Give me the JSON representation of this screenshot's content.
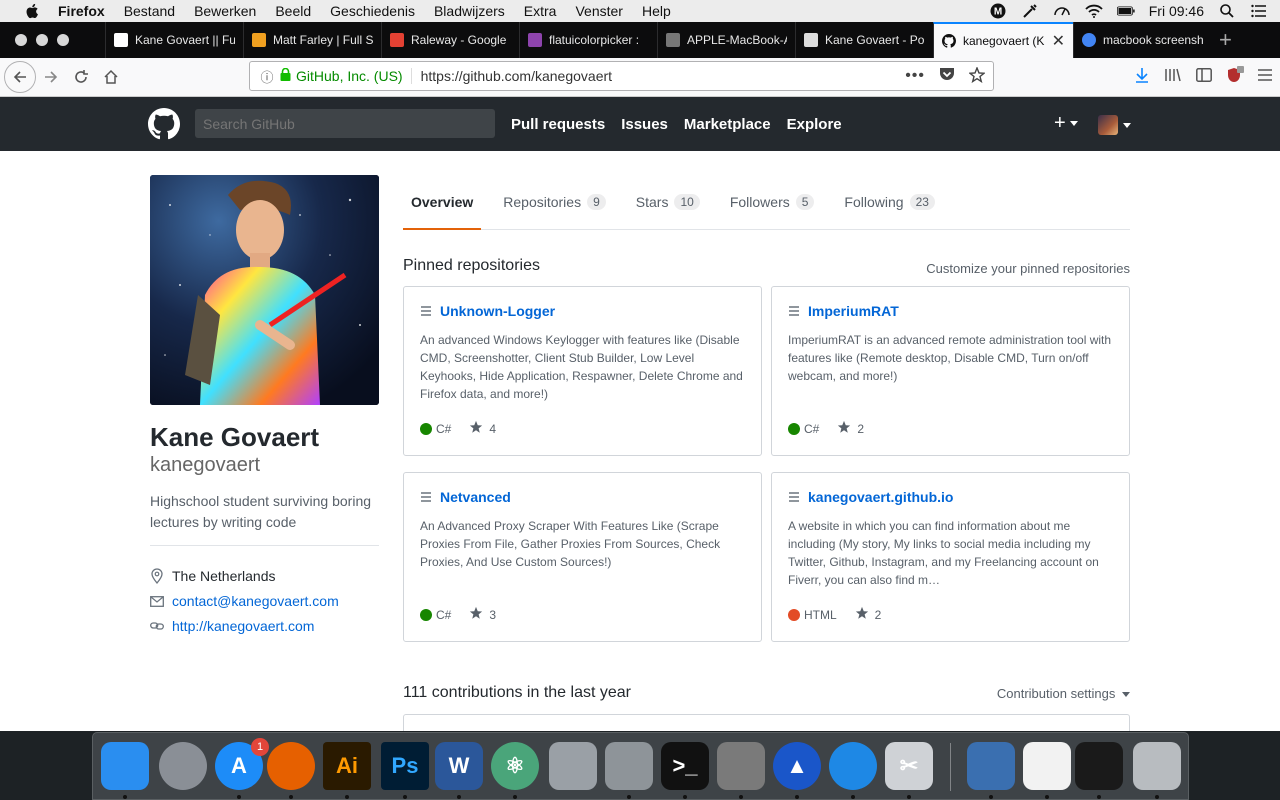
{
  "menubar": {
    "app": "Firefox",
    "items": [
      "Bestand",
      "Bewerken",
      "Beeld",
      "Geschiedenis",
      "Bladwijzers",
      "Extra",
      "Venster",
      "Help"
    ],
    "clock": "Fri 09:46"
  },
  "tabs": [
    {
      "label": "Kane Govaert || Full-St",
      "color": "#ffffff"
    },
    {
      "label": "Matt Farley | Full S",
      "color": "#f0a020"
    },
    {
      "label": "Raleway - Google",
      "color": "#e34133"
    },
    {
      "label": "flatuicolorpicker :",
      "color": "#8e44ad"
    },
    {
      "label": "APPLE-MacBook-A",
      "color": "#777777"
    },
    {
      "label": "Kane Govaert - Po",
      "color": "#dddddd"
    },
    {
      "label": "kanegovaert (K",
      "color": "#111111",
      "active": true
    },
    {
      "label": "macbook screensh",
      "color": "#4285f4"
    }
  ],
  "urlbar": {
    "org": "GitHub, Inc. (US)",
    "url": "https://github.com/kanegovaert"
  },
  "github": {
    "search_placeholder": "Search GitHub",
    "nav": [
      "Pull requests",
      "Issues",
      "Marketplace",
      "Explore"
    ]
  },
  "profile": {
    "fullname": "Kane Govaert",
    "username": "kanegovaert",
    "bio": "Highschool student surviving boring lectures by writing code",
    "location": "The Netherlands",
    "email": "contact@kanegovaert.com",
    "website": "http://kanegovaert.com"
  },
  "profile_tabs": [
    {
      "label": "Overview",
      "count": null,
      "active": true
    },
    {
      "label": "Repositories",
      "count": "9"
    },
    {
      "label": "Stars",
      "count": "10"
    },
    {
      "label": "Followers",
      "count": "5"
    },
    {
      "label": "Following",
      "count": "23"
    }
  ],
  "pinned": {
    "title": "Pinned repositories",
    "customize": "Customize your pinned repositories",
    "repos": [
      {
        "name": "Unknown-Logger",
        "desc": "An advanced Windows Keylogger with features like (Disable CMD, Screenshotter, Client Stub Builder, Low Level Keyhooks, Hide Application, Respawner, Delete Chrome and Firefox data, and more!)",
        "lang": "C#",
        "lang_color": "#178600",
        "stars": "4"
      },
      {
        "name": "ImperiumRAT",
        "desc": "ImperiumRAT is an advanced remote administration tool with features like (Remote desktop, Disable CMD, Turn on/off webcam, and more!)",
        "lang": "C#",
        "lang_color": "#178600",
        "stars": "2"
      },
      {
        "name": "Netvanced",
        "desc": "An Advanced Proxy Scraper With Features Like (Scrape Proxies From File, Gather Proxies From Sources, Check Proxies, And Use Custom Sources!)",
        "lang": "C#",
        "lang_color": "#178600",
        "stars": "3"
      },
      {
        "name": "kanegovaert.github.io",
        "desc": "A website in which you can find information about me including (My story, My links to social media including my Twitter, Github, Instagram, and my Freelancing account on Fiverr, you can also find m…",
        "lang": "HTML",
        "lang_color": "#e34c26",
        "stars": "2"
      }
    ]
  },
  "contributions": {
    "title": "111 contributions in the last year",
    "settings": "Contribution settings"
  },
  "dock": {
    "appstore_badge": "1",
    "apps": [
      {
        "name": "finder",
        "color": "#2a8ef0",
        "glyph": ""
      },
      {
        "name": "launchpad",
        "color": "#8a8f96",
        "glyph": ""
      },
      {
        "name": "app-store",
        "color": "#1d8cf8",
        "glyph": "A"
      },
      {
        "name": "firefox",
        "color": "#e66000",
        "glyph": ""
      },
      {
        "name": "illustrator",
        "color": "#2a1a00",
        "glyph": "Ai"
      },
      {
        "name": "photoshop",
        "color": "#001d34",
        "glyph": "Ps"
      },
      {
        "name": "word",
        "color": "#2b579a",
        "glyph": "W"
      },
      {
        "name": "atom",
        "color": "#4aa57a",
        "glyph": "⚛"
      },
      {
        "name": "archive-utility",
        "color": "#9aa0a6",
        "glyph": ""
      },
      {
        "name": "disk-utility",
        "color": "#8e9499",
        "glyph": ""
      },
      {
        "name": "terminal",
        "color": "#111111",
        "glyph": ">_"
      },
      {
        "name": "transmit",
        "color": "#7a7a7a",
        "glyph": ""
      },
      {
        "name": "nordvpn",
        "color": "#1a56c9",
        "glyph": "▲"
      },
      {
        "name": "safari",
        "color": "#1e88e5",
        "glyph": ""
      },
      {
        "name": "scissors",
        "color": "#cfd2d6",
        "glyph": "✂"
      },
      {
        "name": "finder-window",
        "color": "#3a6fb0",
        "glyph": ""
      },
      {
        "name": "document",
        "color": "#f2f2f2",
        "glyph": ""
      },
      {
        "name": "terminal-window",
        "color": "#1a1a1a",
        "glyph": ""
      },
      {
        "name": "trash",
        "color": "#b8bcc0",
        "glyph": ""
      }
    ]
  }
}
